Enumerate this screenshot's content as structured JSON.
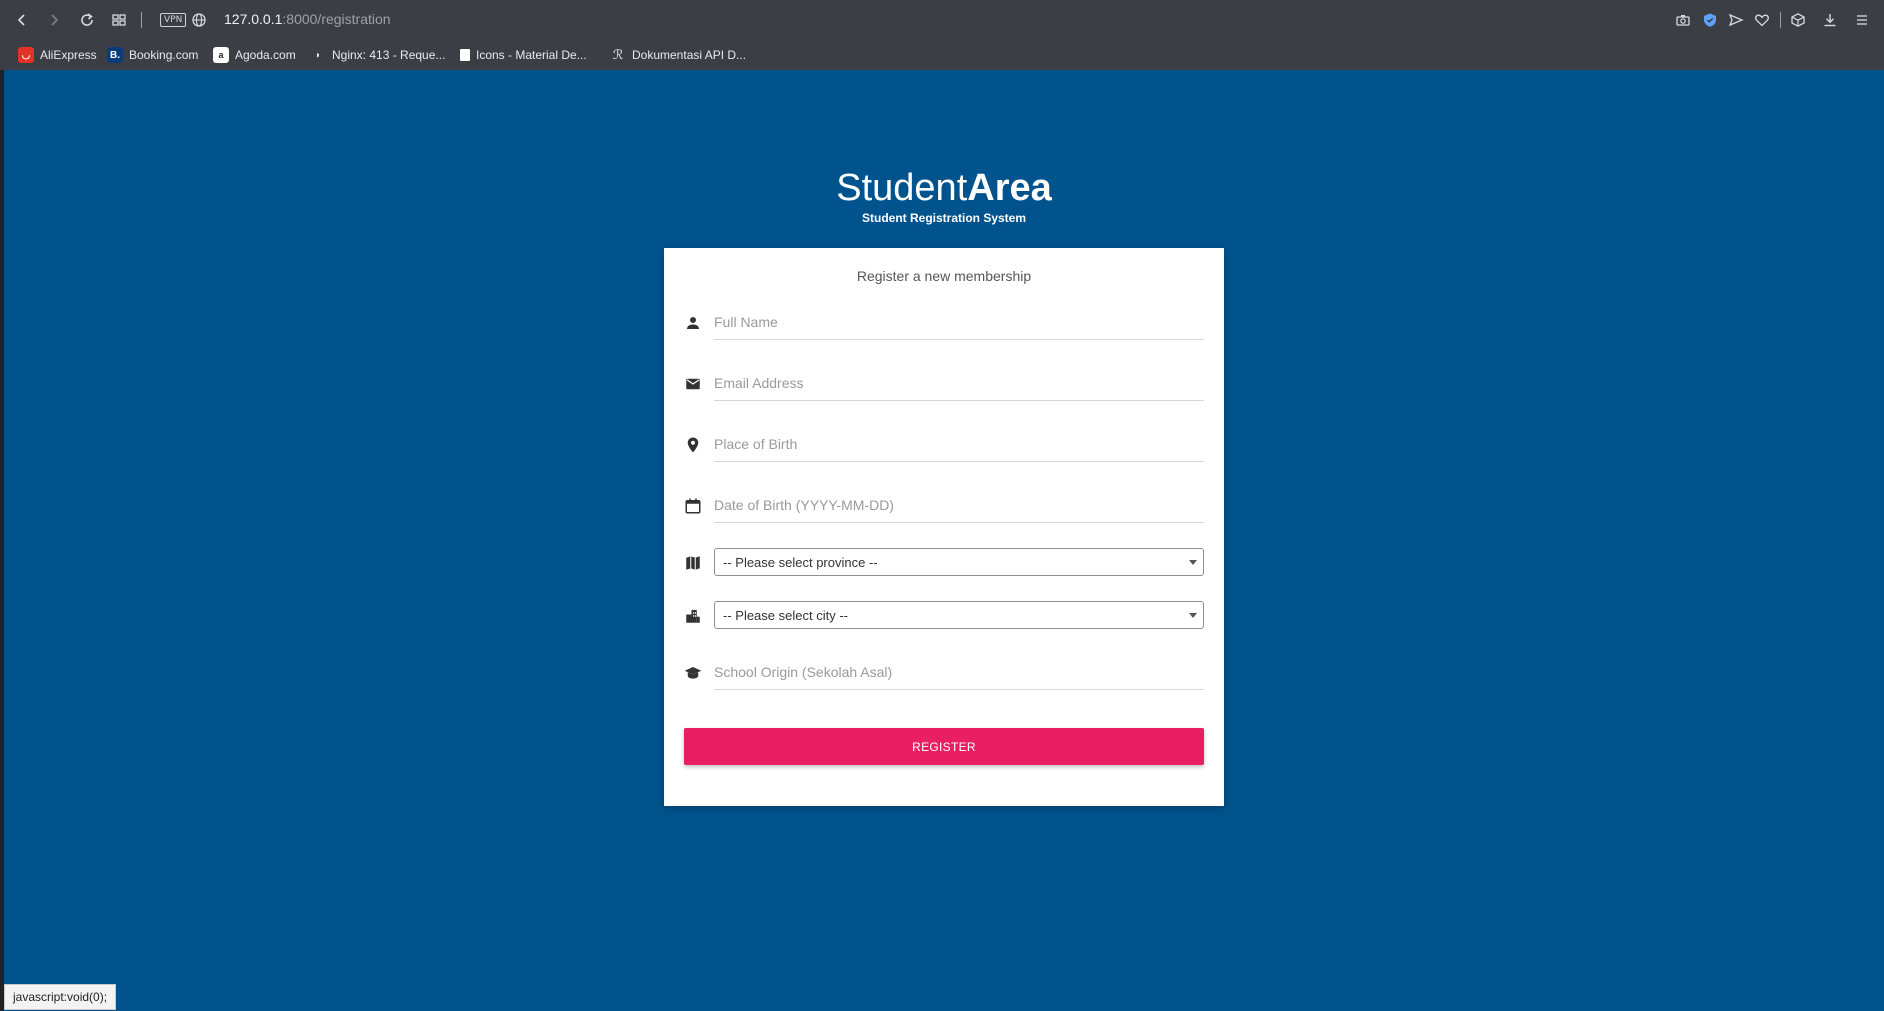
{
  "browser": {
    "url_host": "127.0.0.1",
    "url_path": ":8000/registration",
    "vpn_label": "VPN",
    "bookmarks": [
      {
        "label": "AliExpress",
        "icon": "aliexpress-icon",
        "color": "#e43225"
      },
      {
        "label": "Booking.com",
        "icon": "booking-icon",
        "color": "#0c3b7c"
      },
      {
        "label": "Agoda.com",
        "icon": "agoda-icon",
        "color": "#ffffff"
      },
      {
        "label": "Nginx: 413 - Reque...",
        "icon": "nginx-icon",
        "color": "#3b3f45"
      },
      {
        "label": "Icons - Material De...",
        "icon": "material-icon",
        "color": "#ffffff"
      },
      {
        "label": "Dokumentasi API D...",
        "icon": "api-doc-icon",
        "color": "#3b3f45"
      }
    ]
  },
  "page": {
    "brand_light": "Student",
    "brand_bold": "Area",
    "brand_subtitle": "Student Registration System",
    "background_color": "#00538d",
    "accent_color": "#e91e63"
  },
  "form": {
    "title": "Register a new membership",
    "full_name_placeholder": "Full Name",
    "email_placeholder": "Email Address",
    "place_of_birth_placeholder": "Place of Birth",
    "date_of_birth_placeholder": "Date of Birth (YYYY-MM-DD)",
    "province_selected": "-- Please select province --",
    "city_selected": "-- Please select city --",
    "school_placeholder": "School Origin (Sekolah Asal)",
    "register_label": "REGISTER"
  },
  "status_bar": {
    "text": "javascript:void(0);"
  }
}
